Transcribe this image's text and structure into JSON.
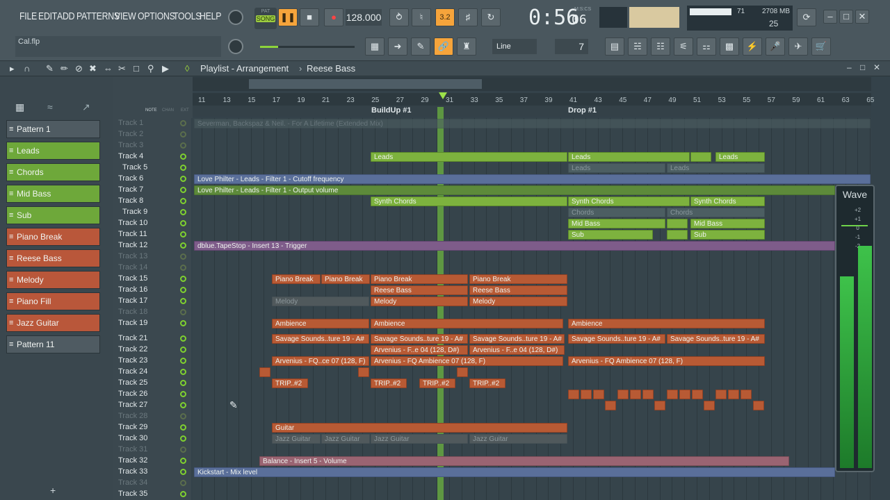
{
  "menu": [
    "FILE",
    "EDIT",
    "ADD",
    "PATTERNS",
    "VIEW",
    "OPTIONS",
    "TOOLS",
    "HELP"
  ],
  "transport": {
    "mode_label": "SONG",
    "pat_label": "PAT",
    "tempo": "128.000",
    "time": "0:56",
    "time_small": "06",
    "time_caption": "M:S:CS"
  },
  "status": {
    "cpu": "71",
    "memory": "2708 MB",
    "voices": "25"
  },
  "file_name": "Cal.flp",
  "snap": {
    "mode": "Line",
    "step": "7"
  },
  "playlist": {
    "title": "Playlist - Arrangement",
    "current": "Reese Bass"
  },
  "pattern_list": [
    {
      "label": "Pattern 1",
      "color": "grey"
    },
    {
      "label": "Leads",
      "color": "green"
    },
    {
      "label": "Chords",
      "color": "green"
    },
    {
      "label": "Mid Bass",
      "color": "green"
    },
    {
      "label": "Sub",
      "color": "green"
    },
    {
      "label": "Piano Break",
      "color": "red"
    },
    {
      "label": "Reese Bass",
      "color": "red"
    },
    {
      "label": "Melody",
      "color": "red"
    },
    {
      "label": "Piano Fill",
      "color": "red"
    },
    {
      "label": "Jazz  Guitar",
      "color": "red"
    },
    {
      "label": "Pattern 11",
      "color": "grey"
    }
  ],
  "track_header_labels": {
    "note": "NOTE",
    "chan": "CHAN",
    "ext": "EXT"
  },
  "tracks": [
    "Track 1",
    "Track 2",
    "Track 3",
    "Track 4",
    "Track 5",
    "Track 6",
    "Track 7",
    "Track 8",
    "Track 9",
    "Track 10",
    "Track 11",
    "Track 12",
    "Track 13",
    "Track 14",
    "Track 15",
    "Track 16",
    "Track 17",
    "Track 18",
    "Track 19",
    "Track 21",
    "Track 22",
    "Track 23",
    "Track 24",
    "Track 25",
    "Track 26",
    "Track 27",
    "Track 28",
    "Track 29",
    "Track 30",
    "Track 31",
    "Track 32",
    "Track 33",
    "Track 34",
    "Track 35"
  ],
  "ruler": [
    "11",
    "13",
    "15",
    "17",
    "19",
    "21",
    "23",
    "25",
    "27",
    "29",
    "31",
    "33",
    "35",
    "37",
    "39",
    "41",
    "43",
    "45",
    "47",
    "49",
    "51",
    "53",
    "55",
    "57",
    "59",
    "61",
    "63",
    "65"
  ],
  "markers": [
    "BuildUp #1",
    "Drop #1"
  ],
  "clips": {
    "audio_top": "Severman, Backspaz & Neil. - For A Lifetime (Extended Mix)",
    "leads": "Leads",
    "auto_cutoff": "Love Philter - Leads - Filter 1 - Cutoff frequency",
    "auto_volume": "Love Philter - Leads - Filter 1 - Output volume",
    "synth_chords": "Synth Chords",
    "chords": "Chords",
    "mid_bass": "Mid Bass",
    "sub": "Sub",
    "tapestop": "dblue.TapeStop - Insert 13 - Trigger",
    "piano_break": "Piano Break",
    "reese_bass": "Reese Bass",
    "melody": "Melody",
    "ambience": "Ambience",
    "savage": "Savage Sounds..ture 19 - A#",
    "arvenius_e04": "Arvenius - F..e 04 (128, D#)",
    "arvenius_fq_short": "Arvenius - FQ..ce 07 (128, F)",
    "arvenius_fq": "Arvenius - FQ Ambience 07 (128, F)",
    "trip": "TRIP..#2",
    "guitar": "Guitar",
    "jazz": "Jazz  Guitar",
    "balance": "Balance - Insert 5 - Volume",
    "kickstart": "Kickstart - Mix level"
  },
  "wave_panel": {
    "title": "Wave",
    "labels": [
      "+2",
      "+1",
      "0",
      "-1",
      "-2"
    ]
  }
}
